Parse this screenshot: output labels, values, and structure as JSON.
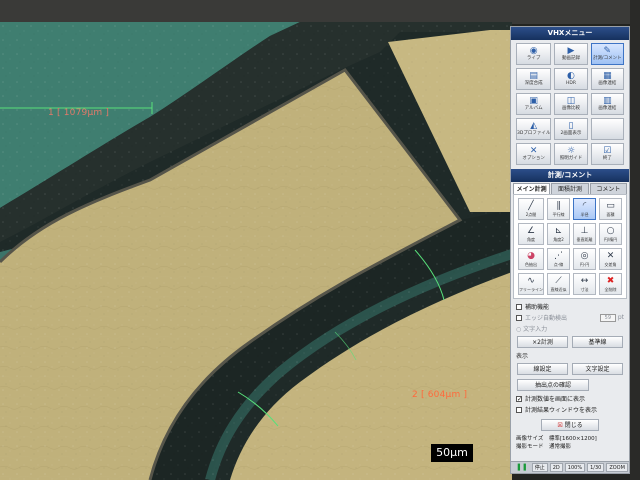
{
  "measurements": {
    "m1": "1 [ 1079μm ]",
    "m2": "2 [ 604μm ]",
    "scale": "50μm"
  },
  "panel": {
    "title": "VHXメニュー",
    "menu": [
      {
        "label": "ライブ",
        "icon": "camera-icon"
      },
      {
        "label": "動画記録",
        "icon": "video-icon"
      },
      {
        "label": "計測/コメント",
        "icon": "measure-icon",
        "active": true
      },
      {
        "label": "深度合成",
        "icon": "depth-icon"
      },
      {
        "label": "HDR",
        "icon": "hdr-icon"
      },
      {
        "label": "画像連結",
        "icon": "stitch-icon"
      },
      {
        "label": "アルバム",
        "icon": "album-icon"
      },
      {
        "label": "画像比較",
        "icon": "compare-icon"
      },
      {
        "label": "画像連結",
        "icon": "join-icon"
      },
      {
        "label": "3Dプロファイル",
        "icon": "profile-icon"
      },
      {
        "label": "2画面表示",
        "icon": "split-icon"
      },
      {
        "label": "",
        "icon": "blank-icon"
      },
      {
        "label": "オプション",
        "icon": "tools-icon"
      },
      {
        "label": "照明ガイド",
        "icon": "guide-icon"
      },
      {
        "label": "終了",
        "icon": "check-icon"
      }
    ],
    "measure_title": "計測/コメント",
    "tabs": [
      "メイン計測",
      "面積計測",
      "コメント"
    ],
    "tools": [
      {
        "label": "2点間",
        "icon": "line-icon"
      },
      {
        "label": "平行線",
        "icon": "parallel-icon"
      },
      {
        "label": "半径",
        "icon": "radius-icon",
        "active": true
      },
      {
        "label": "面積",
        "icon": "area-icon"
      },
      {
        "label": "角度",
        "icon": "angle-icon"
      },
      {
        "label": "角度2",
        "icon": "angle2-icon"
      },
      {
        "label": "垂直距離",
        "icon": "perp-icon"
      },
      {
        "label": "円/楕円",
        "icon": "circle-icon"
      },
      {
        "label": "色抽出",
        "icon": "color-icon"
      },
      {
        "label": "点-線",
        "icon": "point-line-icon"
      },
      {
        "label": "円-円",
        "icon": "circle-circle-icon"
      },
      {
        "label": "交差角",
        "icon": "cross-icon"
      },
      {
        "label": "フリーライン",
        "icon": "freeline-icon"
      },
      {
        "label": "直線近似",
        "icon": "fit-icon"
      },
      {
        "label": "寸法",
        "icon": "dim-icon"
      },
      {
        "label": "全削除",
        "icon": "delete-icon"
      }
    ],
    "assist": "補助機能",
    "edge_auto": "エッジ自動検出",
    "edge_value": "59",
    "edge_unit": "pt",
    "text_input": "○ 文字入力",
    "btn_xy": "×2計測",
    "btn_base": "基準線",
    "display_lbl": "表示",
    "btn_line_set": "線設定",
    "btn_text_set": "文字設定",
    "btn_extract": "抽出点の確認",
    "chk_show_value": "計測数値を画面に表示",
    "chk_result_window": "計測結果ウィンドウを表示",
    "btn_close": "閉じる",
    "info_size": "画像サイズ　標準[1600×1200]",
    "info_mode": "撮影モード　通常撮影",
    "bottom": [
      "停止",
      "2D",
      "",
      "100%",
      "1/30",
      "ZOOM"
    ]
  }
}
